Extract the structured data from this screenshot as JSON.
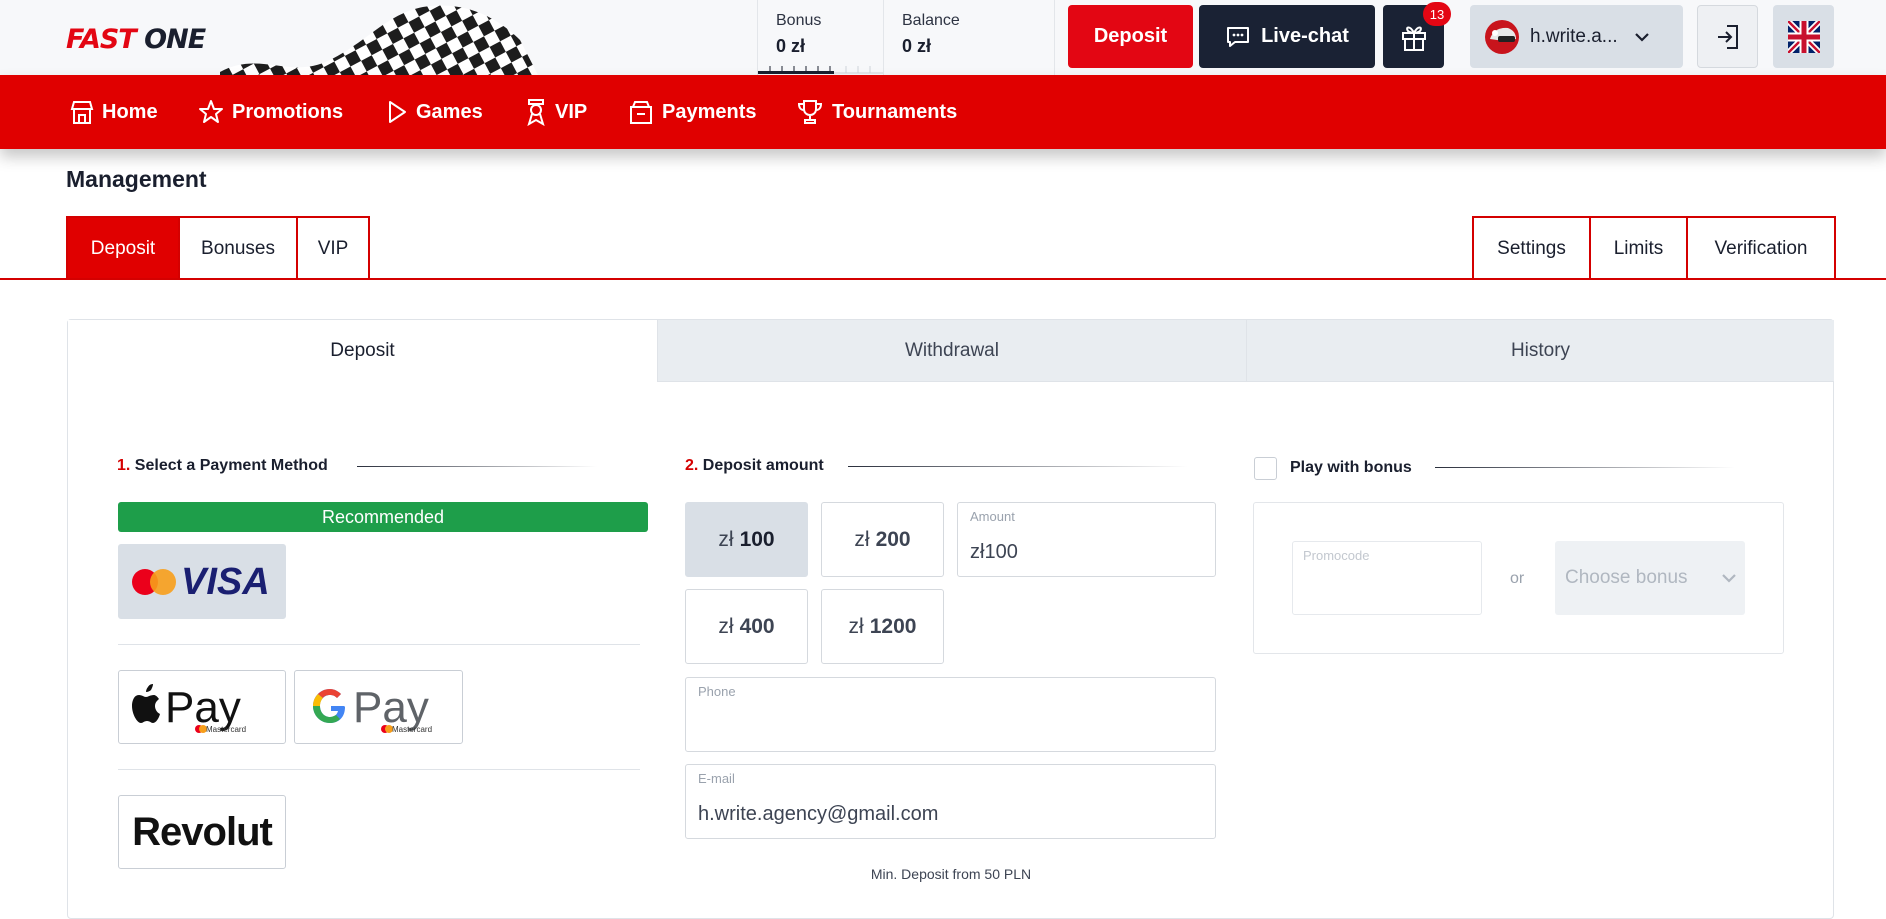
{
  "header": {
    "logo_part1": "FAST",
    "logo_part2": "ONE",
    "bonus_label": "Bonus",
    "bonus_value": "0 zł",
    "balance_label": "Balance",
    "balance_value": "0 zł",
    "deposit_label": "Deposit",
    "livechat_label": "Live-chat",
    "gift_count": "13",
    "username": "h.write.a...",
    "language": "en-GB"
  },
  "nav": {
    "items": [
      {
        "label": "Home",
        "icon": "home-icon"
      },
      {
        "label": "Promotions",
        "icon": "star-icon"
      },
      {
        "label": "Games",
        "icon": "play-icon"
      },
      {
        "label": "VIP",
        "icon": "vip-ribbon-icon"
      },
      {
        "label": "Payments",
        "icon": "wallet-icon"
      },
      {
        "label": "Tournaments",
        "icon": "trophy-icon"
      }
    ]
  },
  "management": {
    "title": "Management",
    "left_tabs": [
      "Deposit",
      "Bonuses",
      "VIP"
    ],
    "right_tabs": [
      "Settings",
      "Limits",
      "Verification"
    ],
    "active_left": "Deposit"
  },
  "panel": {
    "tabs": [
      "Deposit",
      "Withdrawal",
      "History"
    ],
    "active": "Deposit"
  },
  "step1": {
    "num": "1.",
    "title": "Select a Payment Method",
    "recommended": "Recommended",
    "methods": [
      "Mastercard / VISA",
      "Apple Pay",
      "Google Pay",
      "Revolut"
    ],
    "applepay_text": "Pay",
    "googlepay_text": "Pay",
    "mastercard_small": "Mastercard",
    "revolut_text": "Revolut",
    "visa_text": "VISA"
  },
  "step2": {
    "num": "2.",
    "title": "Deposit amount",
    "currency": "zł",
    "presets": [
      "100",
      "200",
      "400",
      "1200"
    ],
    "amount_label": "Amount",
    "amount_value": "zł100",
    "phone_label": "Phone",
    "phone_value": "",
    "email_label": "E-mail",
    "email_value": "h.write.agency@gmail.com",
    "min_deposit": "Min. Deposit from 50 PLN"
  },
  "bonus": {
    "title": "Play with bonus",
    "checked": false,
    "promocode_label": "Promocode",
    "or": "or",
    "choose_bonus": "Choose bonus"
  },
  "colors": {
    "brand_red": "#e00000",
    "dark_navy": "#1a2234",
    "recommended_green": "#1e9e4a"
  }
}
